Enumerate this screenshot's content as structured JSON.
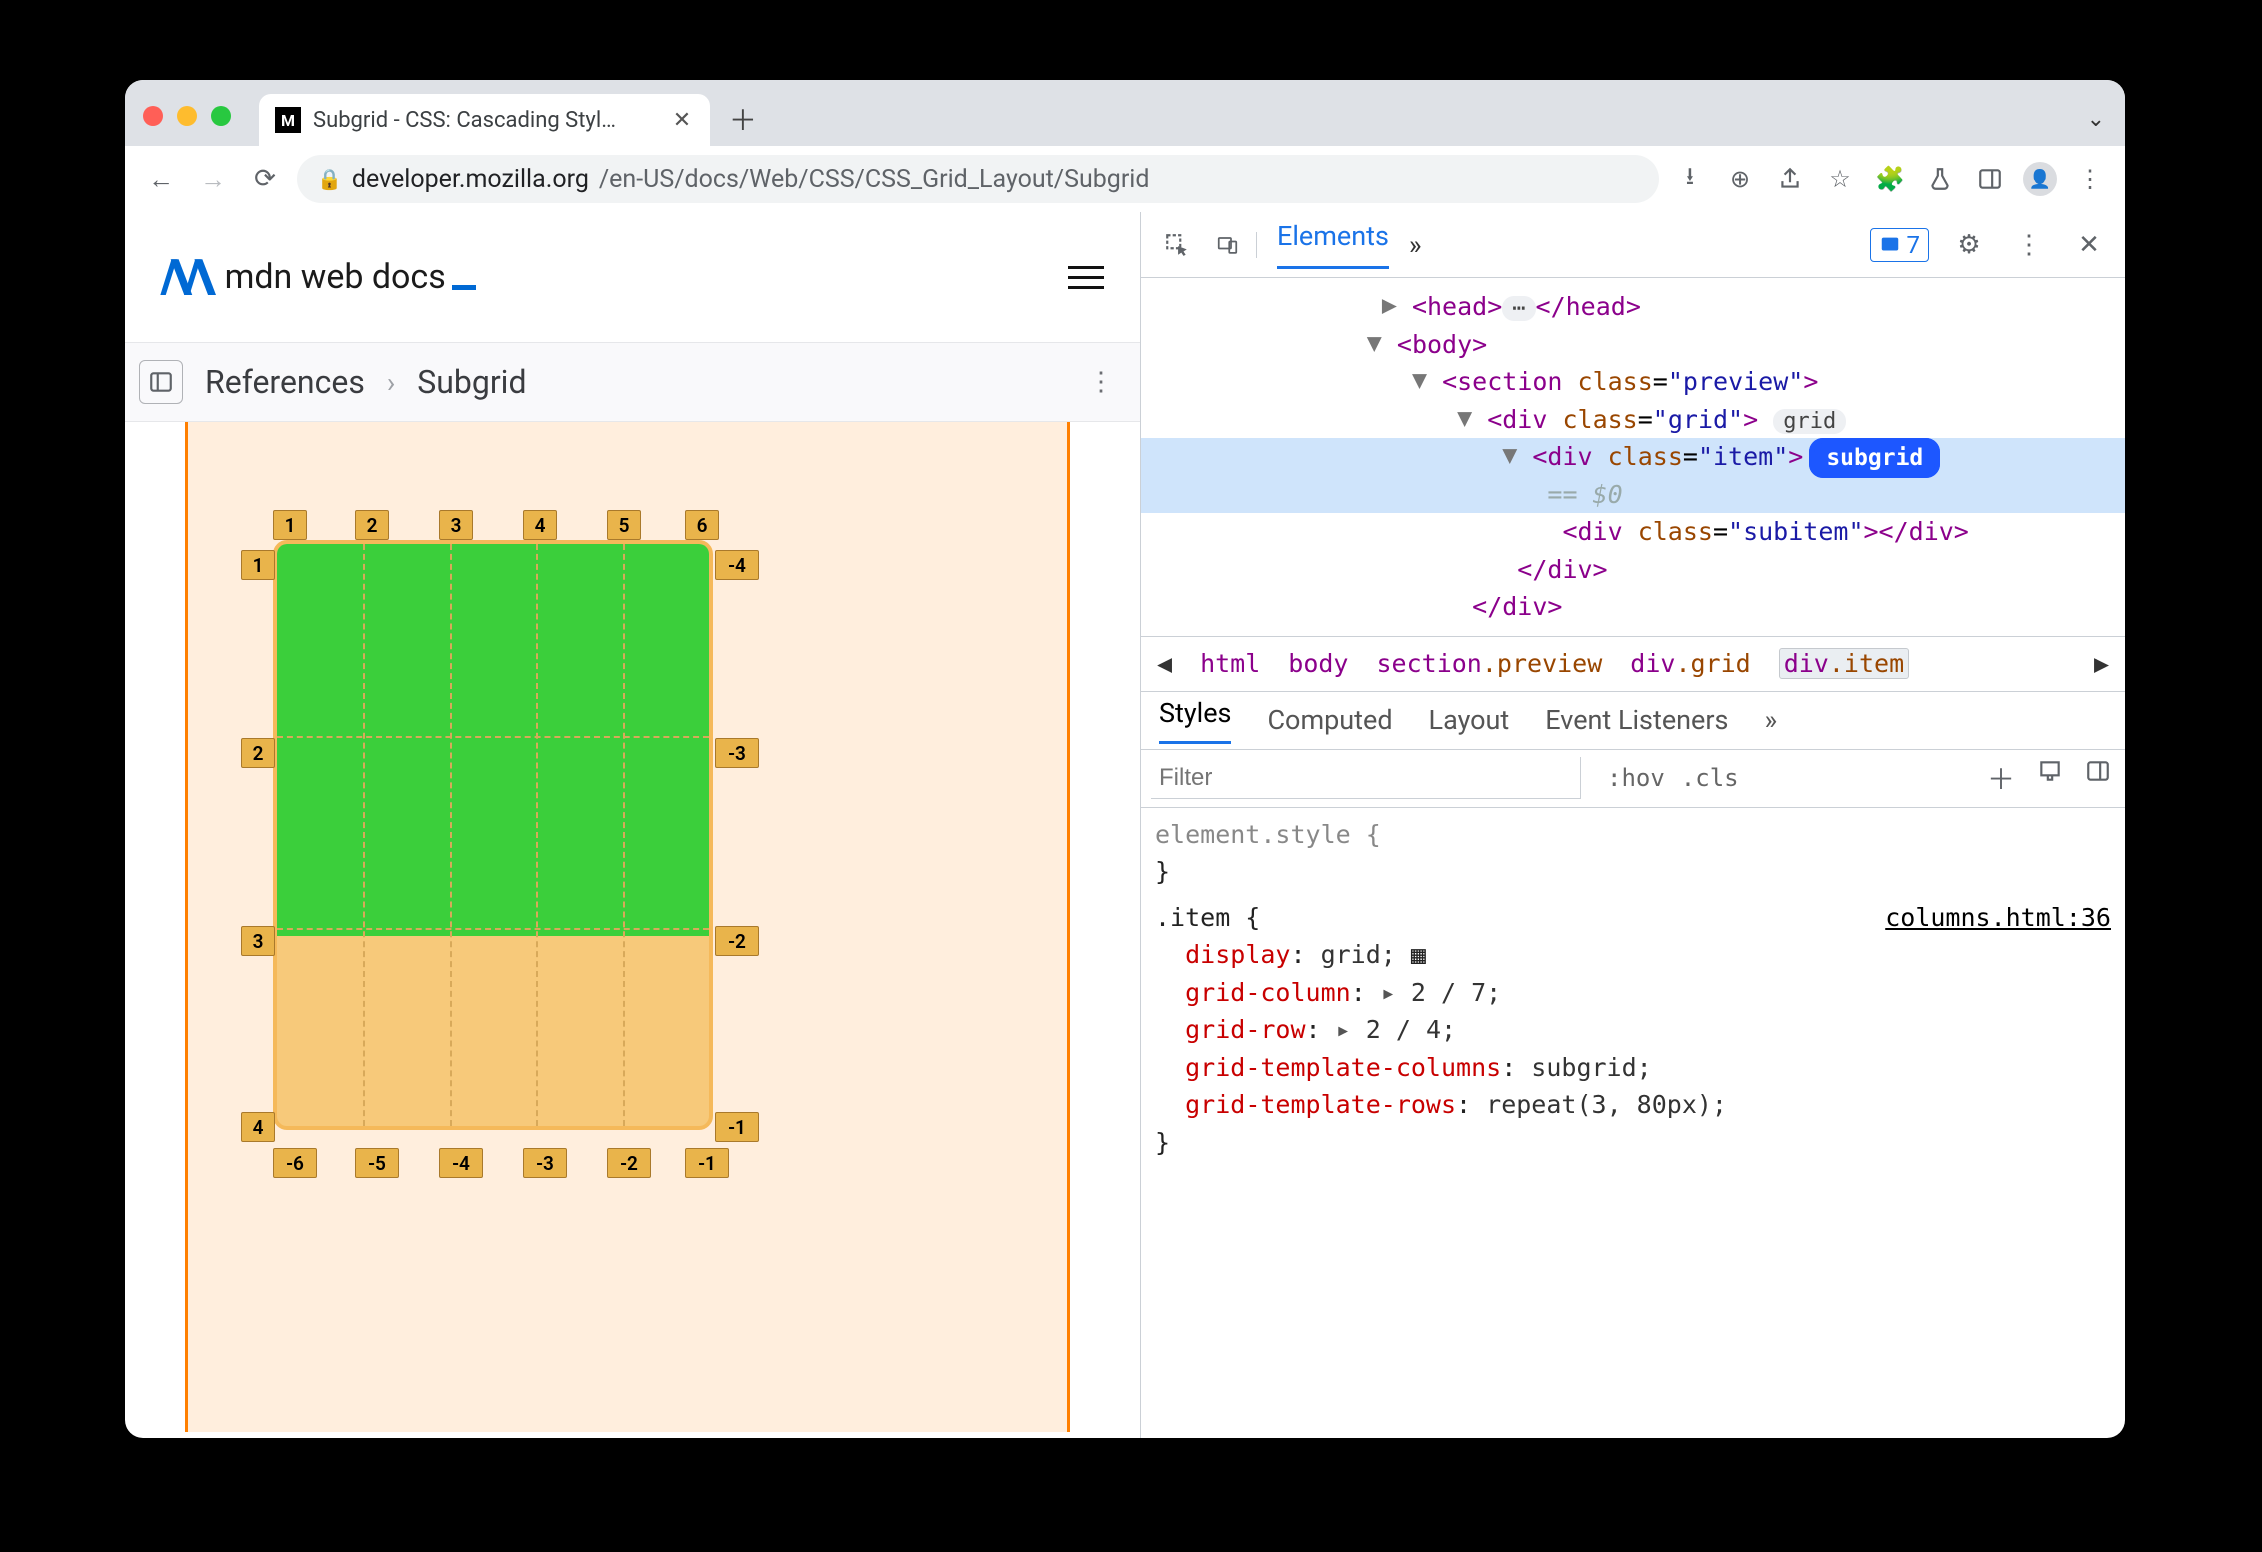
{
  "tab": {
    "title": "Subgrid - CSS: Cascading Styl…",
    "favicon_text": "M"
  },
  "url": {
    "host": "developer.mozilla.org",
    "path": "/en-US/docs/Web/CSS/CSS_Grid_Layout/Subgrid"
  },
  "mdn": {
    "brand": "mdn web docs"
  },
  "breadcrumb": {
    "a": "References",
    "b": "Subgrid"
  },
  "grid_overlay": {
    "top_col_labels": [
      "1",
      "2",
      "3",
      "4",
      "5",
      "6"
    ],
    "left_row_labels": [
      "1",
      "2",
      "3",
      "4"
    ],
    "right_row_labels": [
      "-4",
      "-3",
      "-2",
      "-1"
    ],
    "bottom_col_labels": [
      "-6",
      "-5",
      "-4",
      "-3",
      "-2",
      "-1"
    ]
  },
  "devtools": {
    "tab_active": "Elements",
    "issues": "7",
    "dom": {
      "l1_a": "<head>",
      "l1_b": "</head>",
      "l2": "<body>",
      "l3_a": "<section ",
      "l3_n": "class",
      "l3_v": "\"preview\"",
      "l3_b": ">",
      "l4_a": "<div ",
      "l4_n": "class",
      "l4_v": "\"grid\"",
      "l4_b": ">",
      "l4_pill": "grid",
      "l5_a": "<div ",
      "l5_n": "class",
      "l5_v": "\"item\"",
      "l5_b": ">",
      "l5_pill": "subgrid",
      "l5_eq": "== $0",
      "l6_a": "<div ",
      "l6_n": "class",
      "l6_v": "\"subitem\"",
      "l6_b": "></div>",
      "l7": "</div>",
      "l8": "</div>"
    },
    "bcrumb": {
      "a": "html",
      "b": "body",
      "c": "section",
      "c2": ".preview",
      "d": "div",
      "d2": ".grid",
      "e": "div",
      "e2": ".item"
    },
    "subtabs": {
      "a": "Styles",
      "b": "Computed",
      "c": "Layout",
      "d": "Event Listeners"
    },
    "filter": {
      "ph": "Filter",
      "hov": ":hov",
      "cls": ".cls"
    },
    "styles": {
      "es": "element.style {",
      "selector": ".item {",
      "origin": "columns.html:36",
      "p1": "display",
      "v1": "grid;",
      "p2": "grid-column",
      "v2": "2 / 7;",
      "p3": "grid-row",
      "v3": "2 / 4;",
      "p4": "grid-template-columns",
      "v4": "subgrid;",
      "p5": "grid-template-rows",
      "v5": "repeat(3, 80px);",
      "close": "}"
    }
  }
}
